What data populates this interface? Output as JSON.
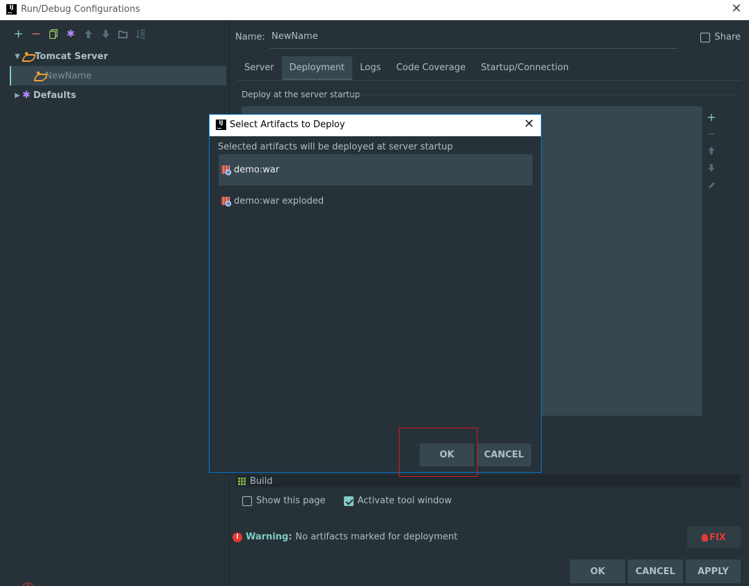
{
  "window": {
    "title": "Run/Debug Configurations",
    "logo": "IJ"
  },
  "toolbar": {
    "icons": [
      "add-icon",
      "remove-icon",
      "copy-icon",
      "gear-icon",
      "arrow-up-icon",
      "arrow-down-icon",
      "folder-icon",
      "sort-icon"
    ],
    "add": "+",
    "remove": "−",
    "up": "🡅",
    "down": "🡇"
  },
  "tree": {
    "tomcat": "Tomcat Server",
    "newname": "NewName",
    "defaults": "Defaults"
  },
  "config": {
    "name_label": "Name:",
    "name_value": "NewName",
    "share_label": "Share",
    "share_checked": false
  },
  "tabs": [
    "Server",
    "Deployment",
    "Logs",
    "Code Coverage",
    "Startup/Connection"
  ],
  "active_tab": "Deployment",
  "deployment": {
    "label": "Deploy at the server startup"
  },
  "before_launch": {
    "build": "Build",
    "show_page": "Show this page",
    "activate_tool": "Activate tool window",
    "show_page_checked": false,
    "activate_tool_checked": true
  },
  "warning": {
    "label": "Warning:",
    "text": "No artifacts marked for deployment",
    "fix": "FIX"
  },
  "buttons": {
    "ok": "OK",
    "cancel": "CANCEL",
    "apply": "APPLY",
    "help": "?"
  },
  "dialog": {
    "title": "Select Artifacts to Deploy",
    "subtitle": "Selected artifacts will be deployed at server startup",
    "artifacts": [
      "demo:war",
      "demo:war exploded"
    ],
    "selected_index": 0,
    "ok": "OK",
    "cancel": "CANCEL"
  },
  "colors": {
    "accent": "#80cbc4",
    "background": "#263238",
    "panel": "#37474f",
    "highlight": "#e0141e"
  }
}
